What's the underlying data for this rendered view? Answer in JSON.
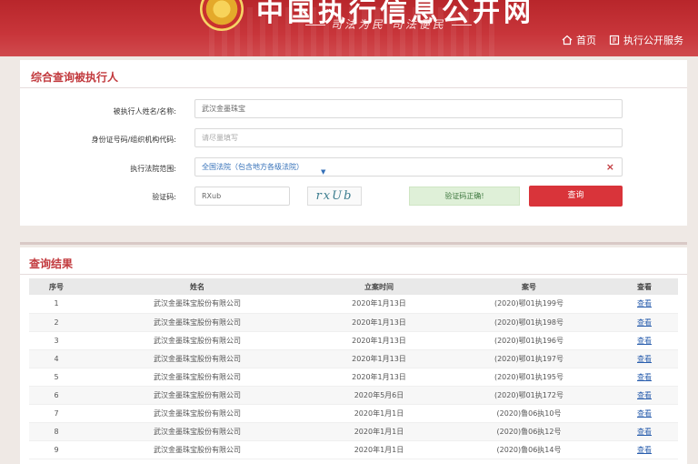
{
  "header": {
    "site_title": "中国执行信息公开网",
    "slogan": "司法为民  司法便民",
    "nav": [
      {
        "label": "首页",
        "icon": "home-icon"
      },
      {
        "label": "执行公开服务",
        "icon": "service-icon"
      }
    ]
  },
  "search": {
    "title": "综合查询被执行人",
    "name_label": "被执行人姓名/名称:",
    "name_value": "武汉金墨珠宝",
    "id_label": "身份证号码/组织机构代码:",
    "id_placeholder": "请尽量填写",
    "court_label": "执行法院范围:",
    "court_value": "全国法院（包含地方各级法院）",
    "captcha_label": "验证码:",
    "captcha_value": "RXub",
    "captcha_image_text": "rxUb",
    "captcha_status": "验证码正确!",
    "query_button": "查询"
  },
  "results": {
    "title": "查询结果",
    "columns": [
      "序号",
      "姓名",
      "立案时间",
      "案号",
      "查看"
    ],
    "rows": [
      {
        "no": "1",
        "name": "武汉金墨珠宝股份有限公司",
        "date": "2020年1月13日",
        "case": "(2020)鄂01执199号",
        "view": "查看"
      },
      {
        "no": "2",
        "name": "武汉金墨珠宝股份有限公司",
        "date": "2020年1月13日",
        "case": "(2020)鄂01执198号",
        "view": "查看"
      },
      {
        "no": "3",
        "name": "武汉金墨珠宝股份有限公司",
        "date": "2020年1月13日",
        "case": "(2020)鄂01执196号",
        "view": "查看"
      },
      {
        "no": "4",
        "name": "武汉金墨珠宝股份有限公司",
        "date": "2020年1月13日",
        "case": "(2020)鄂01执197号",
        "view": "查看"
      },
      {
        "no": "5",
        "name": "武汉金墨珠宝股份有限公司",
        "date": "2020年1月13日",
        "case": "(2020)鄂01执195号",
        "view": "查看"
      },
      {
        "no": "6",
        "name": "武汉金墨珠宝股份有限公司",
        "date": "2020年5月6日",
        "case": "(2020)鄂01执172号",
        "view": "查看"
      },
      {
        "no": "7",
        "name": "武汉金墨珠宝股份有限公司",
        "date": "2020年1月1日",
        "case": "(2020)鲁06执10号",
        "view": "查看"
      },
      {
        "no": "8",
        "name": "武汉金墨珠宝股份有限公司",
        "date": "2020年1月1日",
        "case": "(2020)鲁06执12号",
        "view": "查看"
      },
      {
        "no": "9",
        "name": "武汉金墨珠宝股份有限公司",
        "date": "2020年1月1日",
        "case": "(2020)鲁06执14号",
        "view": "查看"
      }
    ]
  }
}
